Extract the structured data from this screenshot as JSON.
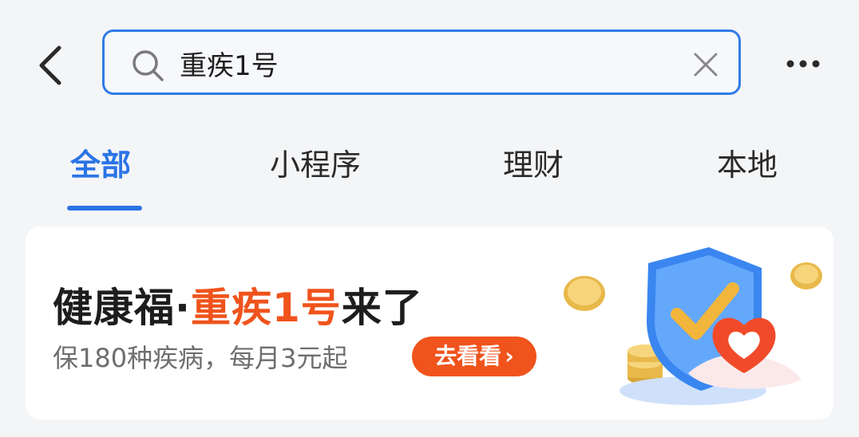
{
  "search": {
    "query": "重疾1号",
    "back_icon": "chevron-left-icon",
    "search_icon": "search-icon",
    "clear_icon": "close-icon",
    "more_icon": "more-dots-icon"
  },
  "tabs": {
    "items": [
      {
        "label": "全部",
        "active": true
      },
      {
        "label": "小程序",
        "active": false
      },
      {
        "label": "理财",
        "active": false
      },
      {
        "label": "本地",
        "active": false
      }
    ]
  },
  "banner": {
    "title_part1": "健康福·",
    "title_highlight": "重疾1号",
    "title_part2": "来了",
    "subtitle": "保180种疾病，每月3元起",
    "cta_label": "去看看",
    "cta_chevron": "›",
    "illustration_icon": "shield-check-heart-coins-icon"
  },
  "colors": {
    "accent_blue": "#2b74e6",
    "accent_orange": "#f0531c",
    "card_bg": "#ffffff",
    "page_bg": "#f4f5f7"
  }
}
